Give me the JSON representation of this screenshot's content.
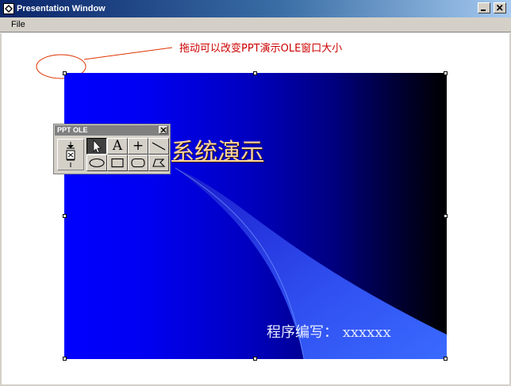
{
  "window": {
    "title": "Presentation Window",
    "icon": "app-icon",
    "controls": [
      "minimize-icon",
      "close-icon"
    ]
  },
  "menu": {
    "items": [
      {
        "label": "File"
      }
    ]
  },
  "annotation": {
    "text": "拖动可以改变PPT演示OLE窗口大小",
    "color": "#cc0000"
  },
  "slide": {
    "title": "系统演示",
    "author": "程序编写：  xxxxxx",
    "title_color": "#ffd5a0",
    "background_left": "#0000ff",
    "background_right": "#000000"
  },
  "toolbox": {
    "title": "PPT OLE",
    "tools": [
      {
        "name": "pointer-tool",
        "glyph": "",
        "icon": "arrow-cursor-icon",
        "active": true
      },
      {
        "name": "text-tool",
        "glyph": "A",
        "icon": "text-icon",
        "active": false
      },
      {
        "name": "cross-tool",
        "glyph": "+",
        "icon": "crosshair-icon",
        "active": false
      },
      {
        "name": "line-tool",
        "glyph": "",
        "icon": "line-icon",
        "active": false
      },
      {
        "name": "ellipse-tool",
        "glyph": "",
        "icon": "ellipse-icon",
        "active": false
      },
      {
        "name": "rectangle-tool",
        "glyph": "",
        "icon": "rectangle-icon",
        "active": false
      },
      {
        "name": "rounded-rectangle-tool",
        "glyph": "",
        "icon": "rounded-rectangle-icon",
        "active": false
      },
      {
        "name": "freeform-tool",
        "glyph": "",
        "icon": "freeform-icon",
        "active": false
      }
    ]
  }
}
